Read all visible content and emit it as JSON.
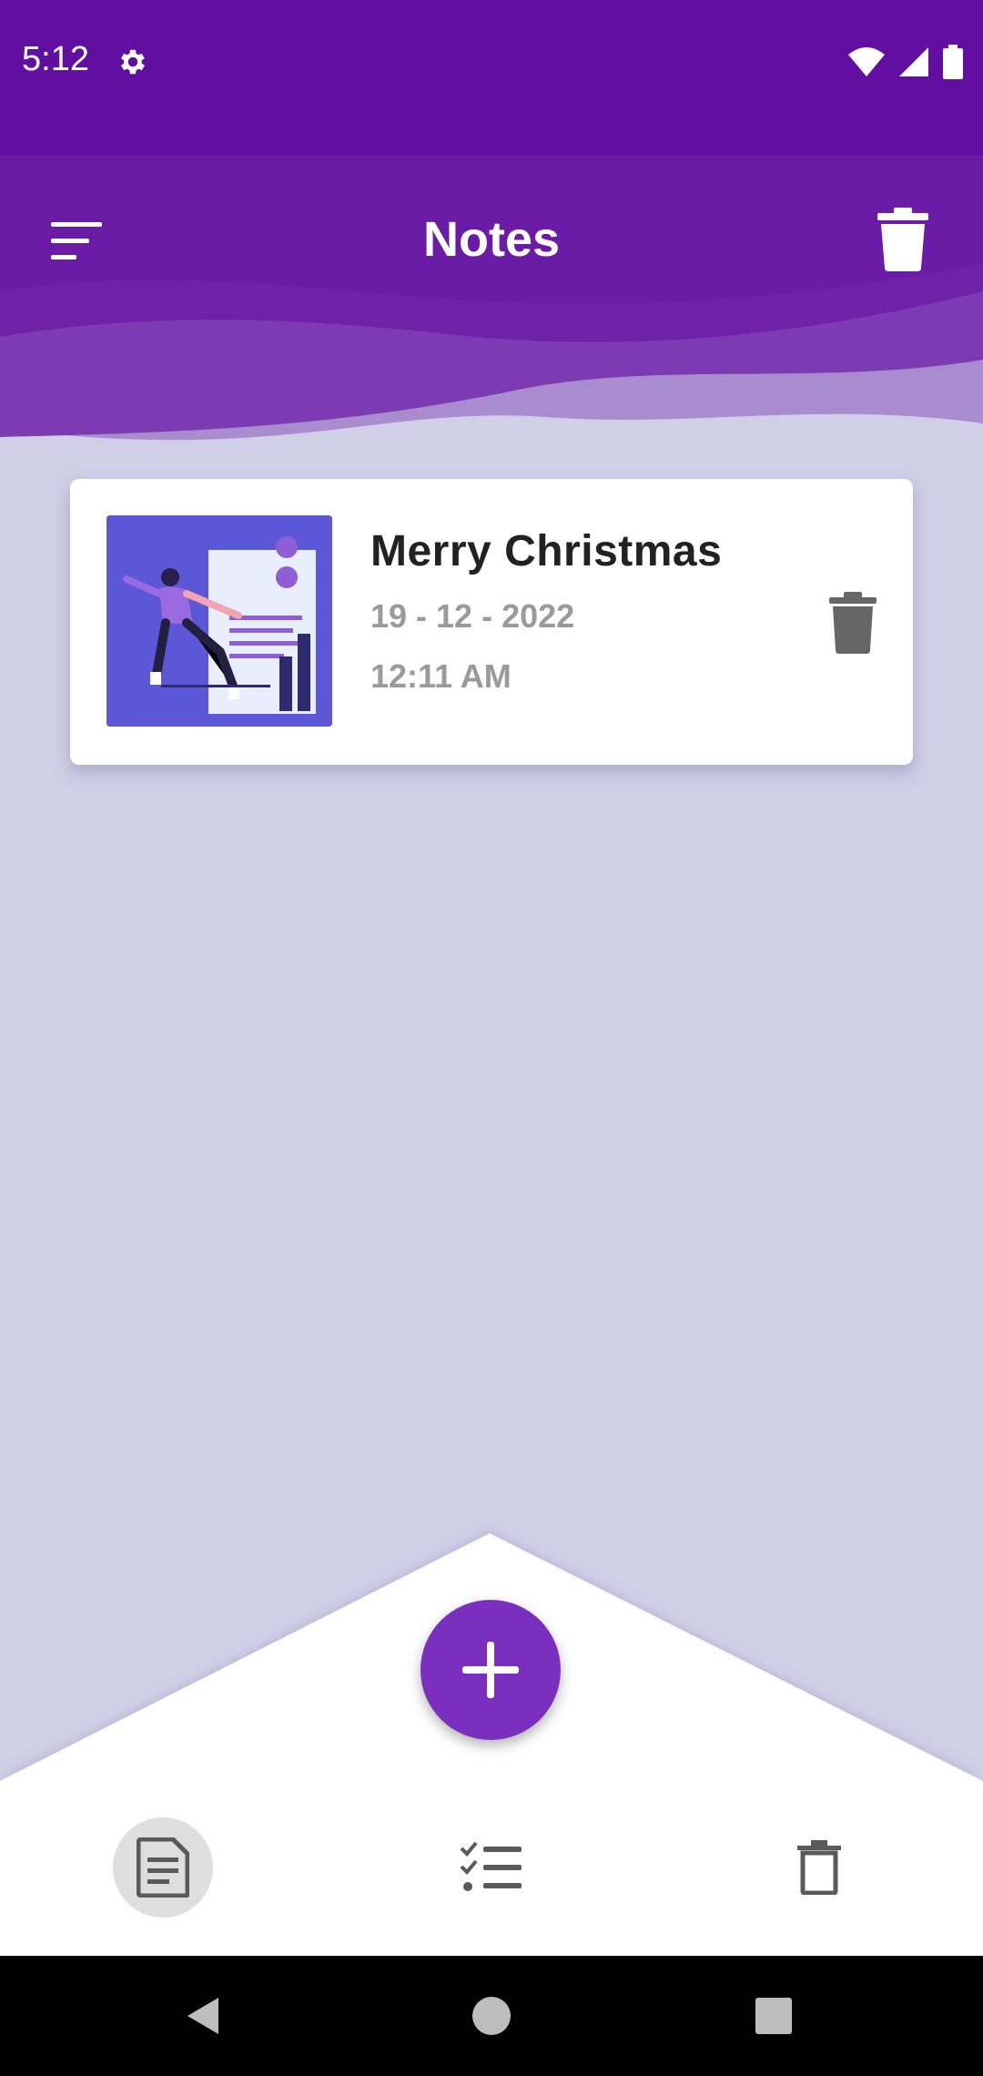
{
  "status_bar": {
    "time": "5:12",
    "icons": [
      "gear-icon",
      "wifi-icon",
      "signal-icon",
      "battery-icon"
    ]
  },
  "header": {
    "title": "Notes",
    "menu_icon": "sort-menu-icon",
    "action_icon": "trash-icon"
  },
  "notes": [
    {
      "title": "Merry Christmas",
      "date": "19 - 12 - 2022",
      "time": "12:11 AM",
      "thumbnail": "illustration-person-document",
      "delete_icon": "trash-icon"
    }
  ],
  "fab": {
    "icon": "plus-icon"
  },
  "bottom_nav": {
    "items": [
      {
        "name": "notes",
        "icon": "document-icon",
        "selected": true
      },
      {
        "name": "tasks",
        "icon": "checklist-icon",
        "selected": false
      },
      {
        "name": "trash",
        "icon": "trash-icon",
        "selected": false
      }
    ]
  },
  "colors": {
    "primary": "#620ea1",
    "header": "#6f21a8",
    "background": "#d1cfe7",
    "fab": "#7b2fbf",
    "thumbnail": "#5b57d6"
  }
}
